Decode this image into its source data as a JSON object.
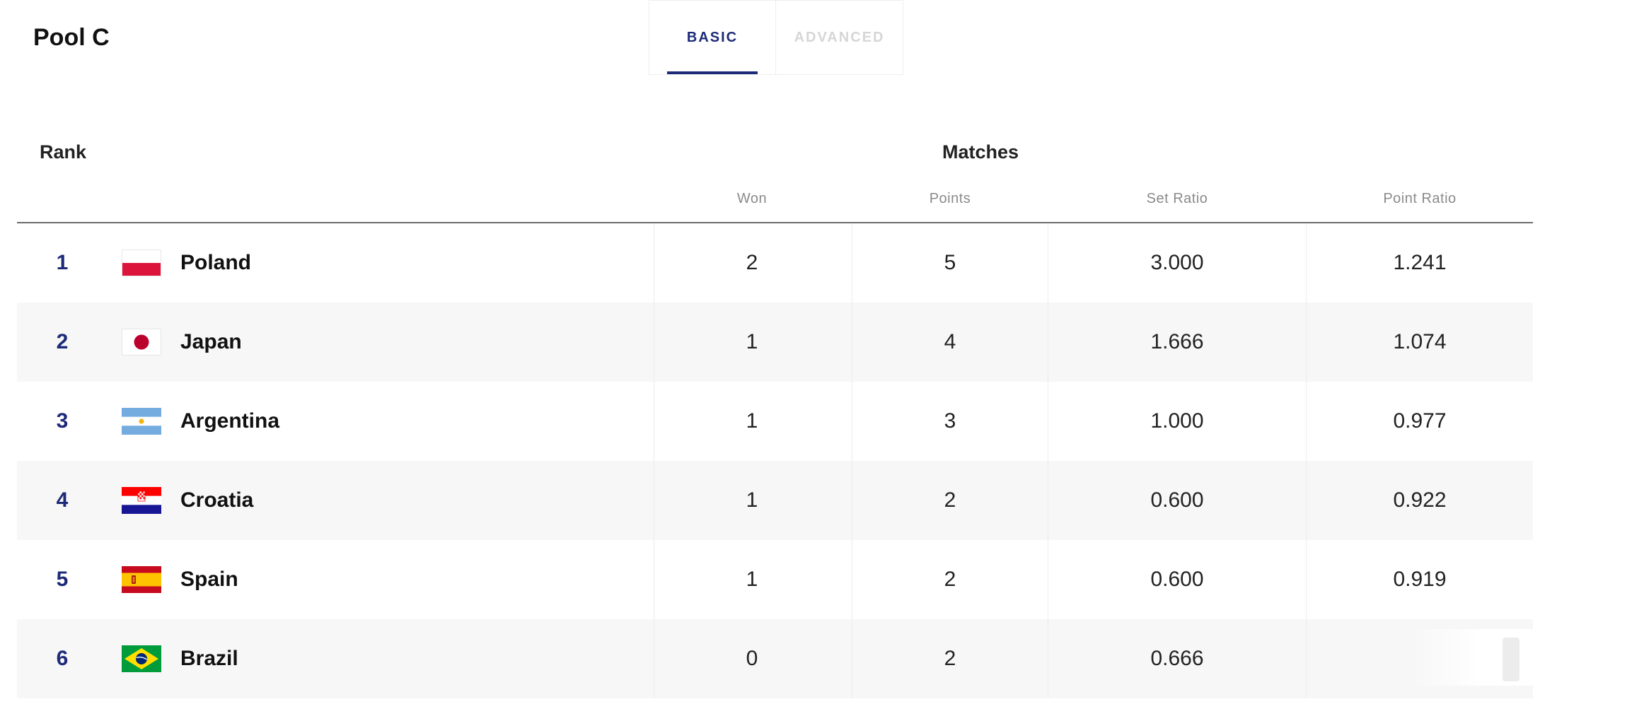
{
  "pool": {
    "title": "Pool C"
  },
  "tabs": [
    {
      "label": "BASIC",
      "active": true
    },
    {
      "label": "ADVANCED",
      "active": false
    }
  ],
  "table": {
    "rank_header": "Rank",
    "group_header": "Matches",
    "columns": [
      "Won",
      "Points",
      "Set Ratio",
      "Point Ratio"
    ],
    "rows": [
      {
        "rank": "1",
        "country": "Poland",
        "flag": "poland-flag",
        "won": "2",
        "points": "5",
        "set_ratio": "3.000",
        "point_ratio": "1.241"
      },
      {
        "rank": "2",
        "country": "Japan",
        "flag": "japan-flag",
        "won": "1",
        "points": "4",
        "set_ratio": "1.666",
        "point_ratio": "1.074"
      },
      {
        "rank": "3",
        "country": "Argentina",
        "flag": "argentina-flag",
        "won": "1",
        "points": "3",
        "set_ratio": "1.000",
        "point_ratio": "0.977"
      },
      {
        "rank": "4",
        "country": "Croatia",
        "flag": "croatia-flag",
        "won": "1",
        "points": "2",
        "set_ratio": "0.600",
        "point_ratio": "0.922"
      },
      {
        "rank": "5",
        "country": "Spain",
        "flag": "spain-flag",
        "won": "1",
        "points": "2",
        "set_ratio": "0.600",
        "point_ratio": "0.919"
      },
      {
        "rank": "6",
        "country": "Brazil",
        "flag": "brazil-flag",
        "won": "0",
        "points": "2",
        "set_ratio": "0.666",
        "point_ratio": ""
      }
    ]
  },
  "colors": {
    "accent": "#1d2a78",
    "row_alt": "#f7f7f7",
    "tab_inactive": "#d6d6d6"
  }
}
